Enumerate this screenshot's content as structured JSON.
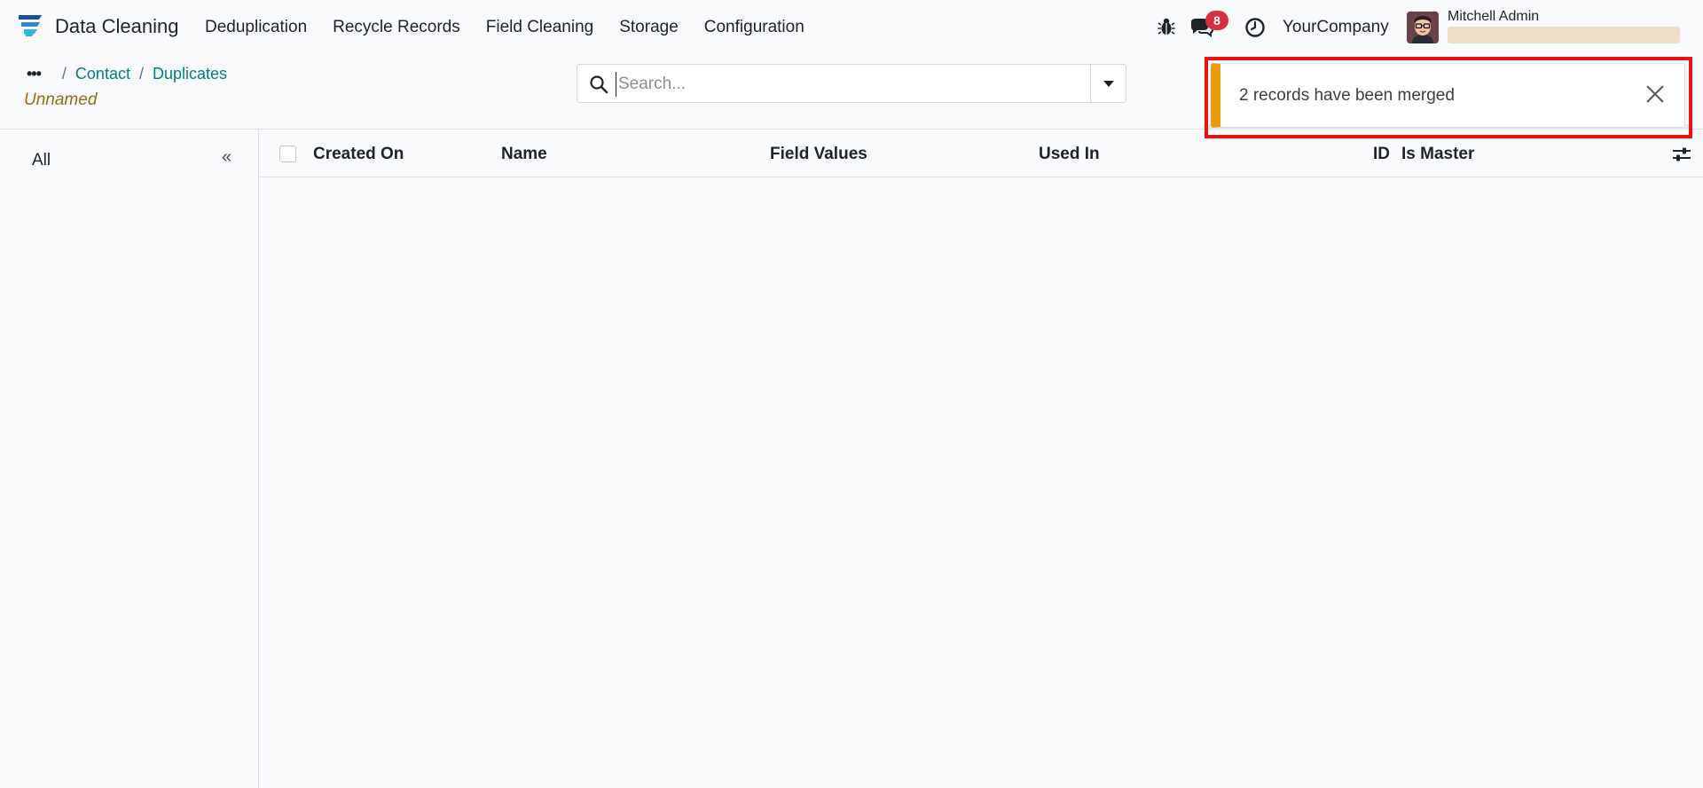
{
  "app": {
    "name": "Data Cleaning",
    "logo_icon": "data-cleaning-logo-icon",
    "accent": "#017e84"
  },
  "menu": [
    "Deduplication",
    "Recycle Records",
    "Field Cleaning",
    "Storage",
    "Configuration"
  ],
  "systray": {
    "debug_icon": "bug-icon",
    "messages_icon": "chat-icon",
    "messages_count": "8",
    "activity_icon": "clock-icon",
    "company": "YourCompany",
    "user_name": "Mitchell Admin"
  },
  "breadcrumb": {
    "ellipsis": "•••",
    "items": [
      "Contact",
      "Duplicates"
    ],
    "separator": "/"
  },
  "record_name": "Unnamed",
  "search": {
    "placeholder": "Search...",
    "value": ""
  },
  "sidepanel": {
    "all_label": "All",
    "collapse_glyph": "«"
  },
  "list": {
    "columns": [
      "Created On",
      "Name",
      "Field Values",
      "Used In",
      "ID",
      "Is Master"
    ],
    "rows": []
  },
  "toast": {
    "message": "2 records have been merged",
    "type_color": "#e89c08",
    "highlight_color": "#ee1111"
  }
}
